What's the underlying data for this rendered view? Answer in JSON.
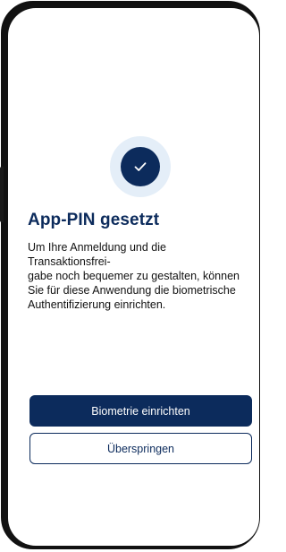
{
  "screen": {
    "status_icon": "checkmark-icon",
    "title": "App-PIN gesetzt",
    "body": "Um Ihre Anmeldung und die Transaktionsfrei-gabe noch bequemer zu gestalten, können Sie für diese Anwendung die biometrische Authentifizierung einrichten.",
    "body_lines": [
      "Um Ihre Anmeldung und die Transaktionsfrei-",
      "gabe noch bequemer zu gestalten, können",
      "Sie für diese Anwendung die biometrische",
      "Authentifizierung einrichten."
    ]
  },
  "actions": {
    "primary_label": "Biometrie einrichten",
    "secondary_label": "Überspringen"
  },
  "colors": {
    "brand": "#0c2b5c",
    "halo": "#e4eef8",
    "frame": "#111111"
  }
}
